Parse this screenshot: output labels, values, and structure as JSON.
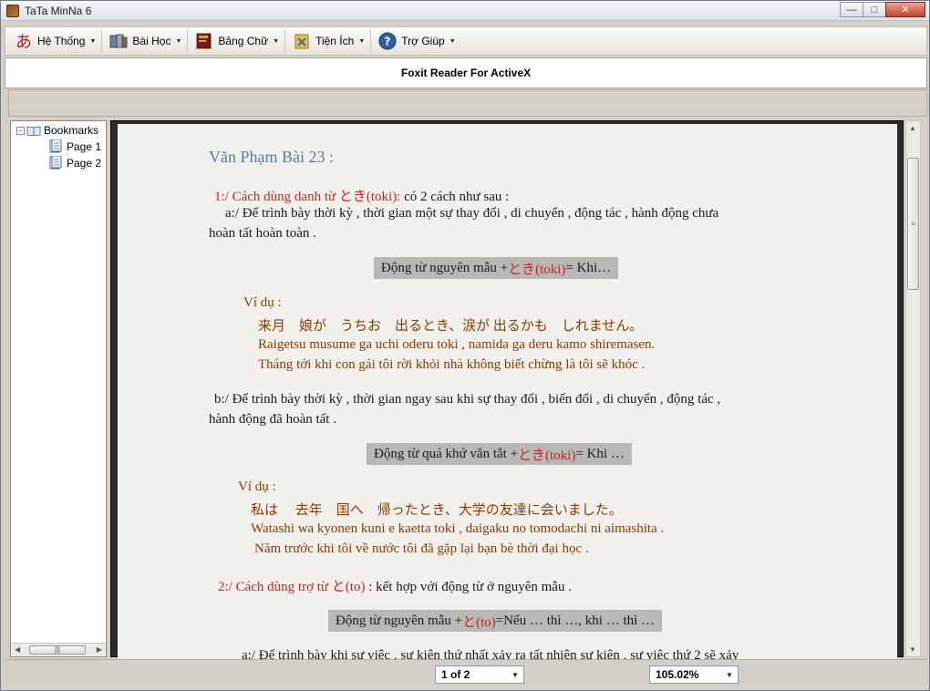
{
  "window": {
    "title": "TaTa MinNa 6"
  },
  "toolbar": {
    "items": [
      {
        "label": "Hệ Thống"
      },
      {
        "label": "Bài Học"
      },
      {
        "label": "Bảng Chữ"
      },
      {
        "label": "Tiện Ích"
      },
      {
        "label": "Trợ Giúp"
      }
    ]
  },
  "viewer_title": "Foxit Reader For ActiveX",
  "bookmarks": {
    "root": "Bookmarks",
    "items": [
      "Page 1",
      "Page 2"
    ]
  },
  "document": {
    "heading": "Văn Phạm Bài 23 :",
    "s1_head": "1:/ Cách dùng danh từ とき(toki):",
    "s1_head_tail": " có 2 cách như sau :",
    "s1a_line1": "a:/ Để trình bày thời kỳ , thời gian một sự thay đổi , di chuyển , động tác , hành động chưa",
    "s1a_line2": "hoàn tất hoàn toàn .",
    "f1_pre": "Động từ nguyên mẫu + ",
    "f1_red": "とき(toki)",
    "f1_post": " = Khi…",
    "ex1_label": "Ví dụ :",
    "ex1_jp": "来月　娘が　うちお　出るとき、涙が 出るかも　しれません。",
    "ex1_romaji": "Raigetsu musume ga uchi oderu toki , namida ga deru kamo shiremasen.",
    "ex1_vi": "Tháng tới khi con gái tôi rời khỏi nhà không biết chừng là tôi sẽ khóc .",
    "s1b_line1": "b:/ Để trình bày thời kỳ , thời gian ngay sau khi sự thay đổi , biến đổi , di chuyển , động tác ,",
    "s1b_line2": "hành động đã hoàn tất .",
    "f2_pre": "Động từ quá khứ vắn tắt + ",
    "f2_red": "とき(toki)",
    "f2_post": " = Khi …",
    "ex2_label": "Ví dụ :",
    "ex2_jp": "私は　 去年　国へ　帰ったとき、大学の友達に会いました。",
    "ex2_romaji": "Watashi wa kyonen kuni e kaetta toki , daigaku no tomodachi ni aimashita .",
    "ex2_vi": "Năm trước khi tôi về nước tôi đã gặp lại bạn bè thời đại học .",
    "s2_head": "2:/ Cách dùng trợ từ と(to)",
    "s2_head_tail": " : kết hợp với động từ ở nguyên mẫu .",
    "f3_pre": "Động từ nguyên mẫu + ",
    "f3_red": "と(to)",
    "f3_post": " =Nếu … thì …, khi … thì …",
    "s2a_partial": "a:/ Để trình bày khi sự việc , sự kiện thứ nhất xảy ra tất nhiên sự kiện , sự việc thứ 2 sẽ xảy"
  },
  "status": {
    "page": "1 of 2",
    "zoom": "105.02%"
  }
}
